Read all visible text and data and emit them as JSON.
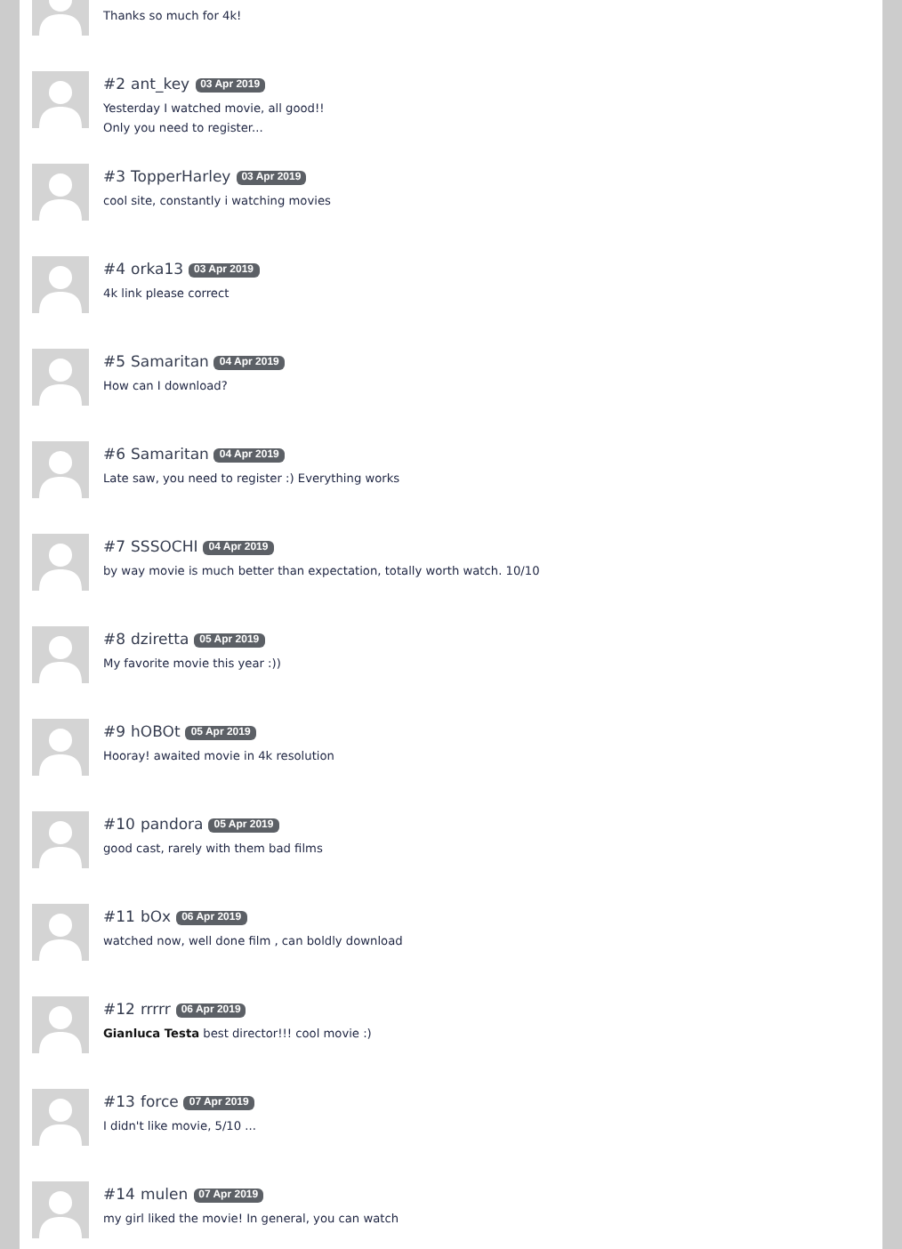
{
  "comments": [
    {
      "text": "Thanks so much for 4k!"
    },
    {
      "number": "#2",
      "author": "ant_key",
      "date": "03 Apr 2019",
      "text": "Yesterday I watched movie, all good!!\nOnly you need to register..."
    },
    {
      "number": "#3",
      "author": "TopperHarley",
      "date": "03 Apr 2019",
      "text": "cool site, constantly i watching movies"
    },
    {
      "number": "#4",
      "author": "orka13",
      "date": "03 Apr 2019",
      "text": "4k link please correct"
    },
    {
      "number": "#5",
      "author": "Samaritan",
      "date": "04 Apr 2019",
      "text": "How can I download?"
    },
    {
      "number": "#6",
      "author": "Samaritan",
      "date": "04 Apr 2019",
      "text": "Late saw, you need to register :) Everything works"
    },
    {
      "number": "#7",
      "author": "SSSOCHI",
      "date": "04 Apr 2019",
      "text": "by way movie is much better than expectation, totally worth watch. 10/10"
    },
    {
      "number": "#8",
      "author": "dziretta",
      "date": "05 Apr 2019",
      "text": "My favorite movie this year :))"
    },
    {
      "number": "#9",
      "author": "hOBOt",
      "date": "05 Apr 2019",
      "text": "Hooray! awaited movie in 4k resolution"
    },
    {
      "number": "#10",
      "author": "pandora",
      "date": "05 Apr 2019",
      "text": "good cast, rarely with them bad films"
    },
    {
      "number": "#11",
      "author": "bOx",
      "date": "06 Apr 2019",
      "text": "watched now, well done film , can boldly download"
    },
    {
      "number": "#12",
      "author": "rrrrr",
      "date": "06 Apr 2019",
      "text": "**Gianluca Testa** best director!!! cool movie :)"
    },
    {
      "number": "#13",
      "author": "force",
      "date": "07 Apr 2019",
      "text": "I didn't like movie, 5/10 ..."
    },
    {
      "number": "#14",
      "author": "mulen",
      "date": "07 Apr 2019",
      "text": "my girl liked the movie! In general, you can watch"
    }
  ]
}
